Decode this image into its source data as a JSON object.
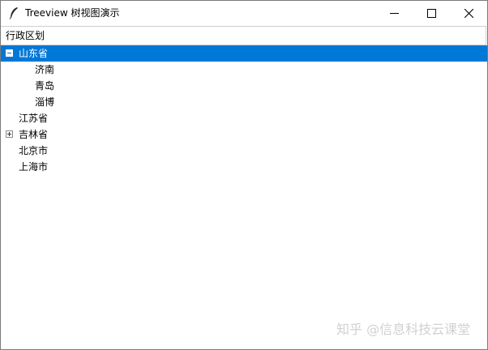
{
  "window": {
    "title": "Treeview 树视图演示",
    "icon": "feather-icon",
    "controls": [
      "minimize-icon",
      "maximize-icon",
      "close-icon"
    ]
  },
  "tree": {
    "heading": "行政区划",
    "selected_color": "#0078d7",
    "nodes": [
      {
        "label": "山东省",
        "expanded": true,
        "selected": true,
        "toggle": "collapse-icon",
        "children": [
          {
            "label": "济南"
          },
          {
            "label": "青岛"
          },
          {
            "label": "淄博"
          }
        ]
      },
      {
        "label": "江苏省"
      },
      {
        "label": "吉林省",
        "expanded": false,
        "toggle": "expand-icon"
      },
      {
        "label": "北京市"
      },
      {
        "label": "上海市"
      }
    ]
  },
  "watermark": "知乎 @信息科技云课堂"
}
